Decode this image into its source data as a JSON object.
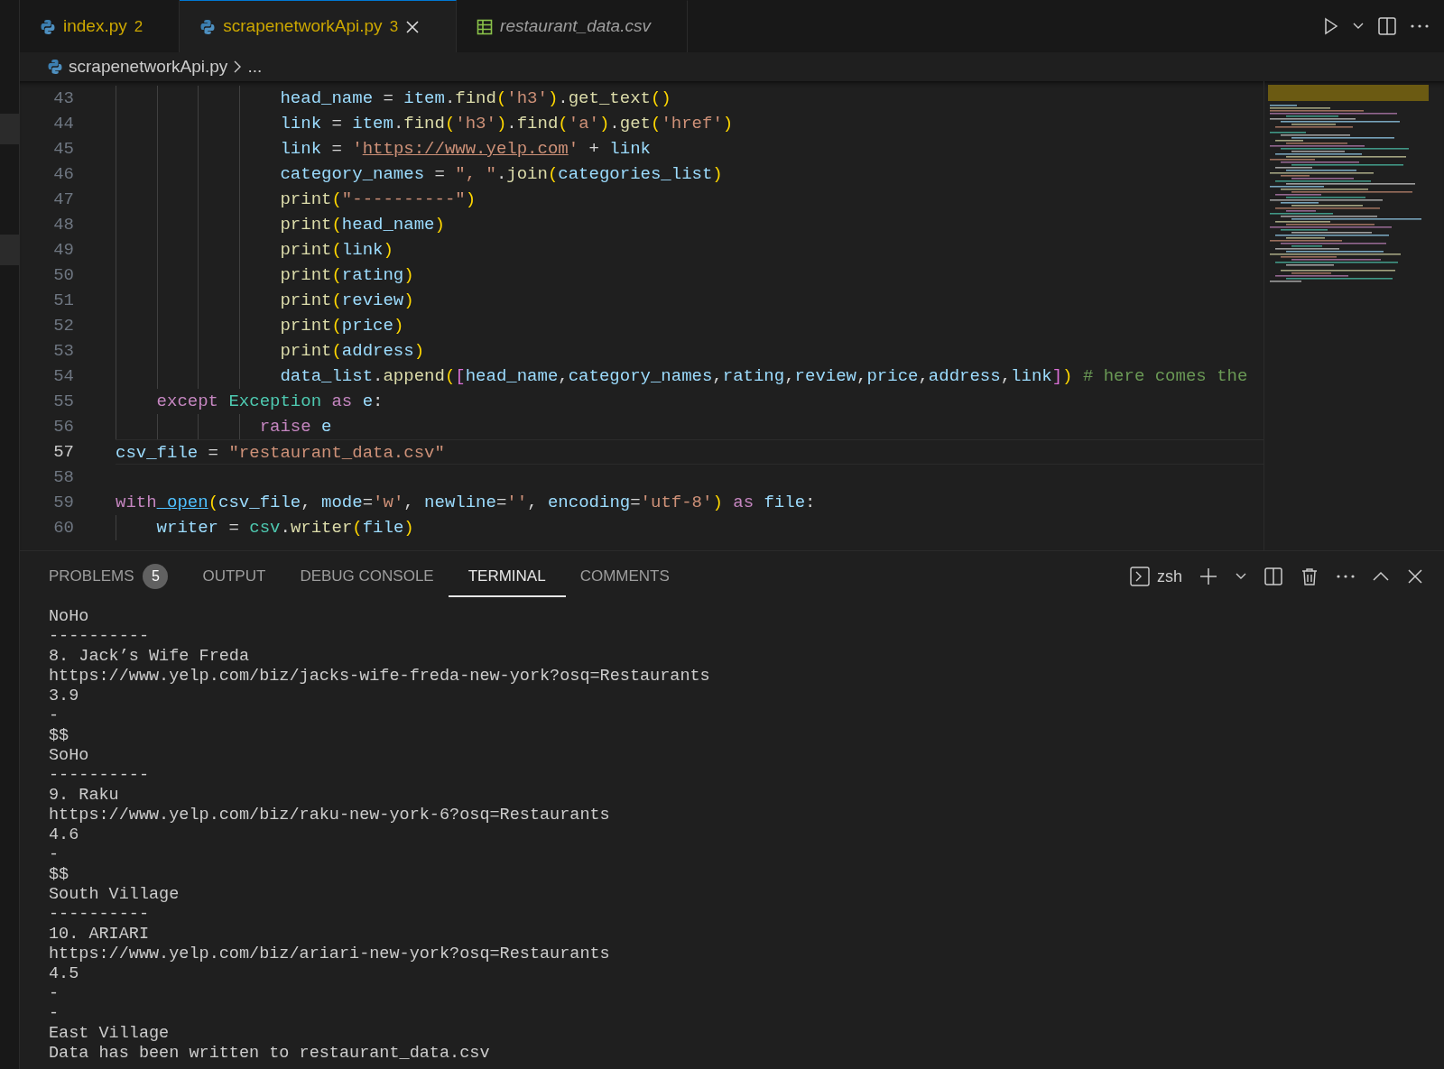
{
  "tabs": [
    {
      "label": "index.py",
      "badge": "2",
      "selected": false,
      "preview": false,
      "kind": "python",
      "closable": false
    },
    {
      "label": "scrapenetworkApi.py",
      "badge": "3",
      "selected": true,
      "preview": false,
      "kind": "python",
      "closable": true
    },
    {
      "label": "restaurant_data.csv",
      "selected": false,
      "preview": true,
      "kind": "csv",
      "closable": false
    }
  ],
  "breadcrumb": {
    "file": "scrapenetworkApi.py",
    "rest": "..."
  },
  "code_lines": [
    {
      "number": "43",
      "current": false,
      "tokens": [
        {
          "kind": "var",
          "text": "                head_name"
        },
        {
          "kind": "plain",
          "text": " = "
        },
        {
          "kind": "var",
          "text": "item"
        },
        {
          "kind": "plain",
          "text": "."
        },
        {
          "kind": "fn",
          "text": "find"
        },
        {
          "kind": "b1",
          "text": "("
        },
        {
          "kind": "str",
          "text": "'h3'"
        },
        {
          "kind": "b1",
          "text": ")"
        },
        {
          "kind": "plain",
          "text": "."
        },
        {
          "kind": "fn",
          "text": "get_text"
        },
        {
          "kind": "b1",
          "text": "()"
        }
      ]
    },
    {
      "number": "44",
      "current": false,
      "tokens": [
        {
          "kind": "var",
          "text": "                link"
        },
        {
          "kind": "plain",
          "text": " = "
        },
        {
          "kind": "var",
          "text": "item"
        },
        {
          "kind": "plain",
          "text": "."
        },
        {
          "kind": "fn",
          "text": "find"
        },
        {
          "kind": "b1",
          "text": "("
        },
        {
          "kind": "str",
          "text": "'h3'"
        },
        {
          "kind": "b1",
          "text": ")"
        },
        {
          "kind": "plain",
          "text": "."
        },
        {
          "kind": "fn",
          "text": "find"
        },
        {
          "kind": "b1",
          "text": "("
        },
        {
          "kind": "str",
          "text": "'a'"
        },
        {
          "kind": "b1",
          "text": ")"
        },
        {
          "kind": "plain",
          "text": "."
        },
        {
          "kind": "fn",
          "text": "get"
        },
        {
          "kind": "b1",
          "text": "("
        },
        {
          "kind": "str",
          "text": "'href'"
        },
        {
          "kind": "b1",
          "text": ")"
        }
      ]
    },
    {
      "number": "45",
      "current": false,
      "tokens": [
        {
          "kind": "var",
          "text": "                link"
        },
        {
          "kind": "plain",
          "text": " = "
        },
        {
          "kind": "str",
          "text": "'"
        },
        {
          "kind": "url",
          "text": "https://www.yelp.com"
        },
        {
          "kind": "str",
          "text": "'"
        },
        {
          "kind": "plain",
          "text": " + "
        },
        {
          "kind": "var",
          "text": "link"
        }
      ]
    },
    {
      "number": "46",
      "current": false,
      "tokens": [
        {
          "kind": "var",
          "text": "                category_names"
        },
        {
          "kind": "plain",
          "text": " = "
        },
        {
          "kind": "str",
          "text": "\", \""
        },
        {
          "kind": "plain",
          "text": "."
        },
        {
          "kind": "fn",
          "text": "join"
        },
        {
          "kind": "b1",
          "text": "("
        },
        {
          "kind": "var",
          "text": "categories_list"
        },
        {
          "kind": "b1",
          "text": ")"
        }
      ]
    },
    {
      "number": "47",
      "current": false,
      "tokens": [
        {
          "kind": "fn",
          "text": "                print"
        },
        {
          "kind": "b1",
          "text": "("
        },
        {
          "kind": "str",
          "text": "\"----------\""
        },
        {
          "kind": "b1",
          "text": ")"
        }
      ]
    },
    {
      "number": "48",
      "current": false,
      "tokens": [
        {
          "kind": "fn",
          "text": "                print"
        },
        {
          "kind": "b1",
          "text": "("
        },
        {
          "kind": "var",
          "text": "head_name"
        },
        {
          "kind": "b1",
          "text": ")"
        }
      ]
    },
    {
      "number": "49",
      "current": false,
      "tokens": [
        {
          "kind": "fn",
          "text": "                print"
        },
        {
          "kind": "b1",
          "text": "("
        },
        {
          "kind": "var",
          "text": "link"
        },
        {
          "kind": "b1",
          "text": ")"
        }
      ]
    },
    {
      "number": "50",
      "current": false,
      "tokens": [
        {
          "kind": "fn",
          "text": "                print"
        },
        {
          "kind": "b1",
          "text": "("
        },
        {
          "kind": "var",
          "text": "rating"
        },
        {
          "kind": "b1",
          "text": ")"
        }
      ]
    },
    {
      "number": "51",
      "current": false,
      "tokens": [
        {
          "kind": "fn",
          "text": "                print"
        },
        {
          "kind": "b1",
          "text": "("
        },
        {
          "kind": "var",
          "text": "review"
        },
        {
          "kind": "b1",
          "text": ")"
        }
      ]
    },
    {
      "number": "52",
      "current": false,
      "tokens": [
        {
          "kind": "fn",
          "text": "                print"
        },
        {
          "kind": "b1",
          "text": "("
        },
        {
          "kind": "var",
          "text": "price"
        },
        {
          "kind": "b1",
          "text": ")"
        }
      ]
    },
    {
      "number": "53",
      "current": false,
      "tokens": [
        {
          "kind": "fn",
          "text": "                print"
        },
        {
          "kind": "b1",
          "text": "("
        },
        {
          "kind": "var",
          "text": "address"
        },
        {
          "kind": "b1",
          "text": ")"
        }
      ]
    },
    {
      "number": "54",
      "current": false,
      "tokens": [
        {
          "kind": "var",
          "text": "                data_list"
        },
        {
          "kind": "plain",
          "text": "."
        },
        {
          "kind": "fn",
          "text": "append"
        },
        {
          "kind": "b1",
          "text": "("
        },
        {
          "kind": "b2",
          "text": "["
        },
        {
          "kind": "var",
          "text": "head_name"
        },
        {
          "kind": "plain",
          "text": ","
        },
        {
          "kind": "var",
          "text": "category_names"
        },
        {
          "kind": "plain",
          "text": ","
        },
        {
          "kind": "var",
          "text": "rating"
        },
        {
          "kind": "plain",
          "text": ","
        },
        {
          "kind": "var",
          "text": "review"
        },
        {
          "kind": "plain",
          "text": ","
        },
        {
          "kind": "var",
          "text": "price"
        },
        {
          "kind": "plain",
          "text": ","
        },
        {
          "kind": "var",
          "text": "address"
        },
        {
          "kind": "plain",
          "text": ","
        },
        {
          "kind": "var",
          "text": "link"
        },
        {
          "kind": "b2",
          "text": "]"
        },
        {
          "kind": "b1",
          "text": ")"
        },
        {
          "kind": "comment",
          "text": " # here comes the"
        }
      ]
    },
    {
      "number": "55",
      "current": false,
      "tokens": [
        {
          "kind": "kw",
          "text": "    except"
        },
        {
          "kind": "cls",
          "text": " Exception"
        },
        {
          "kind": "kw",
          "text": " as"
        },
        {
          "kind": "var",
          "text": " e"
        },
        {
          "kind": "plain",
          "text": ":"
        }
      ]
    },
    {
      "number": "56",
      "current": false,
      "tokens": [
        {
          "kind": "kw",
          "text": "              raise"
        },
        {
          "kind": "var",
          "text": " e"
        }
      ]
    },
    {
      "number": "57",
      "current": true,
      "tokens": [
        {
          "kind": "var",
          "text": "csv_file"
        },
        {
          "kind": "plain",
          "text": " = "
        },
        {
          "kind": "str",
          "text": "\"restaurant_data.csv\""
        }
      ]
    },
    {
      "number": "58",
      "current": false
    },
    {
      "number": "59",
      "current": false,
      "tokens": [
        {
          "kind": "kw",
          "text": "with"
        },
        {
          "kind": "link",
          "text": " open"
        },
        {
          "kind": "b1",
          "text": "("
        },
        {
          "kind": "var",
          "text": "csv_file"
        },
        {
          "kind": "plain",
          "text": ", "
        },
        {
          "kind": "var",
          "text": "mode"
        },
        {
          "kind": "plain",
          "text": "="
        },
        {
          "kind": "str",
          "text": "'w'"
        },
        {
          "kind": "plain",
          "text": ", "
        },
        {
          "kind": "var",
          "text": "newline"
        },
        {
          "kind": "plain",
          "text": "="
        },
        {
          "kind": "str",
          "text": "''"
        },
        {
          "kind": "plain",
          "text": ", "
        },
        {
          "kind": "var",
          "text": "encoding"
        },
        {
          "kind": "plain",
          "text": "="
        },
        {
          "kind": "str",
          "text": "'utf-8'"
        },
        {
          "kind": "b1",
          "text": ")"
        },
        {
          "kind": "kw",
          "text": " as"
        },
        {
          "kind": "var",
          "text": " file"
        },
        {
          "kind": "plain",
          "text": ":"
        }
      ]
    },
    {
      "number": "60",
      "current": false,
      "tokens": [
        {
          "kind": "var",
          "text": "    writer"
        },
        {
          "kind": "plain",
          "text": " = "
        },
        {
          "kind": "cls",
          "text": "csv"
        },
        {
          "kind": "plain",
          "text": "."
        },
        {
          "kind": "fn",
          "text": "writer"
        },
        {
          "kind": "b1",
          "text": "("
        },
        {
          "kind": "var",
          "text": "file"
        },
        {
          "kind": "b1",
          "text": ")"
        }
      ]
    }
  ],
  "panel": {
    "tabs": [
      {
        "label": "PROBLEMS",
        "count": "5",
        "selected": false
      },
      {
        "label": "OUTPUT",
        "selected": false
      },
      {
        "label": "DEBUG CONSOLE",
        "selected": false
      },
      {
        "label": "TERMINAL",
        "selected": true
      },
      {
        "label": "COMMENTS",
        "selected": false
      }
    ],
    "shell": "zsh"
  },
  "terminal_lines": [
    "NoHo",
    "----------",
    "8. Jack’s Wife Freda",
    "https://www.yelp.com/biz/jacks-wife-freda-new-york?osq=Restaurants",
    "3.9",
    "-",
    "$$",
    "SoHo",
    "----------",
    "9. Raku",
    "https://www.yelp.com/biz/raku-new-york-6?osq=Restaurants",
    "4.6",
    "-",
    "$$",
    "South Village",
    "----------",
    "10. ARIARI",
    "https://www.yelp.com/biz/ariari-new-york?osq=Restaurants",
    "4.5",
    "-",
    "-",
    "East Village",
    "Data has been written to restaurant_data.csv"
  ]
}
